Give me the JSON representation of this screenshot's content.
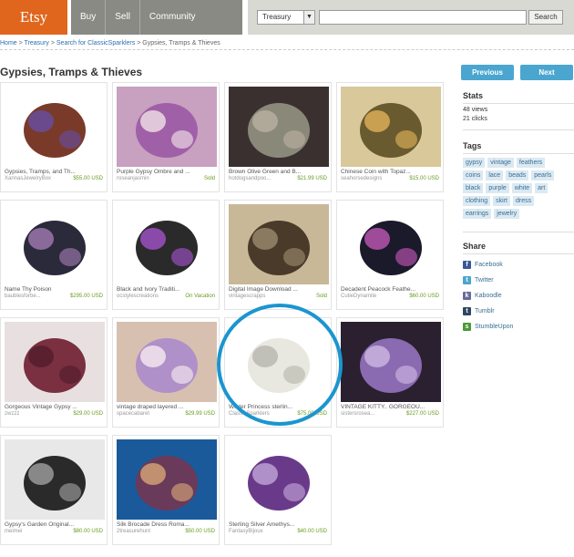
{
  "header": {
    "logo": "Etsy",
    "nav": [
      "Buy",
      "Sell",
      "Community"
    ],
    "search_select": "Treasury",
    "search_button": "Search"
  },
  "breadcrumb": {
    "home": "Home",
    "treasury": "Treasury",
    "search": "Search for ClassicSparklers",
    "current": "Gypsies, Tramps & Thieves"
  },
  "page_title": "Gypsies, Tramps & Thieves",
  "buttons": {
    "previous": "Previous",
    "next": "Next"
  },
  "items": [
    {
      "title": "Gypsies, Tramps, and Th...",
      "shop": "XannasJewelryBox",
      "price": "$55.00 USD",
      "colors": [
        "#ffffff",
        "#7a3a2a",
        "#6a4a8a"
      ]
    },
    {
      "title": "Purple Gypsy Ombre and ...",
      "shop": "roseanjasmin",
      "price": "Sold",
      "colors": [
        "#c8a0c0",
        "#a060a8",
        "#e0c8d8"
      ]
    },
    {
      "title": "Brown Olive Green and B...",
      "shop": "hotdogsandpoo...",
      "price": "$21.99 USD",
      "colors": [
        "#3a3030",
        "#8a8878",
        "#b0a898"
      ]
    },
    {
      "title": "Chinese Coin with Topaz...",
      "shop": "seahorsedesigns",
      "price": "$15.00 USD",
      "colors": [
        "#d8c89a",
        "#6a5a30",
        "#c8a050"
      ]
    },
    {
      "title": "Name Thy Poison",
      "shop": "baublesforbe...",
      "price": "$295.00 USD",
      "colors": [
        "#ffffff",
        "#2a2a3a",
        "#8a6a9a"
      ]
    },
    {
      "title": "Black and Ivory Traditi...",
      "shop": "ocstylescreations",
      "price": "On Vacation",
      "colors": [
        "#ffffff",
        "#2a2a2a",
        "#8a4aaa"
      ]
    },
    {
      "title": "Digital Image Download ...",
      "shop": "vintagescrapps",
      "price": "Sold",
      "colors": [
        "#c8b898",
        "#4a3a2a",
        "#8a7a60"
      ]
    },
    {
      "title": "Decadent Peacock Feathe...",
      "shop": "CutieDynamite",
      "price": "$60.00 USD",
      "colors": [
        "#ffffff",
        "#1a1a2a",
        "#a04a9a"
      ]
    },
    {
      "title": "Gorgeous Vintage Gypsy ...",
      "shop": "zwzzz",
      "price": "$29.00 USD",
      "colors": [
        "#e8e0e0",
        "#7a3040",
        "#5a2030"
      ]
    },
    {
      "title": "vintage draped layered ...",
      "shop": "spacecabaret",
      "price": "$29.99 USD",
      "colors": [
        "#d8c0b0",
        "#b090c8",
        "#e8d8e8"
      ]
    },
    {
      "title": "Winter Princess sterlin...",
      "shop": "ClassicSparklers",
      "price": "$75.00 USD",
      "colors": [
        "#ffffff",
        "#e8e8e0",
        "#c0c0b8"
      ]
    },
    {
      "title": "VINTAGE KITTY.. GORGEOU...",
      "shop": "sistersrosea...",
      "price": "$227.00 USD",
      "colors": [
        "#2a2030",
        "#8a6ab0",
        "#c0a8d8"
      ]
    },
    {
      "title": "Gypsy's Garden Original...",
      "shop": "meimei",
      "price": "$80.00 USD",
      "colors": [
        "#e8e8e8",
        "#2a2a2a",
        "#888888"
      ]
    },
    {
      "title": "Silk Brocade Dress Roma...",
      "shop": "2treasurehunt",
      "price": "$50.00 USD",
      "colors": [
        "#1a5a9a",
        "#6a3a5a",
        "#c09070"
      ]
    },
    {
      "title": "Sterling Silver Amethys...",
      "shop": "FantasyBijoux",
      "price": "$40.00 USD",
      "colors": [
        "#ffffff",
        "#6a3a8a",
        "#b090c8"
      ]
    }
  ],
  "sidebar": {
    "stats_title": "Stats",
    "views": "48 views",
    "clicks": "21 clicks",
    "tags_title": "Tags",
    "tags": [
      "gypsy",
      "vintage",
      "feathers",
      "coins",
      "lace",
      "beads",
      "pearls",
      "black",
      "purple",
      "white",
      "art",
      "clothing",
      "skirt",
      "dress",
      "earrings",
      "jewelry"
    ],
    "share_title": "Share",
    "share": [
      {
        "label": "Facebook",
        "icon": "facebook-icon",
        "color": "#3b5998",
        "glyph": "f"
      },
      {
        "label": "Twitter",
        "icon": "twitter-icon",
        "color": "#4aa6cf",
        "glyph": "t"
      },
      {
        "label": "Kaboodle",
        "icon": "kaboodle-icon",
        "color": "#6a6a9a",
        "glyph": "k"
      },
      {
        "label": "Tumblr",
        "icon": "tumblr-icon",
        "color": "#2c4762",
        "glyph": "t"
      },
      {
        "label": "StumbleUpon",
        "icon": "stumbleupon-icon",
        "color": "#4a9a3a",
        "glyph": "s"
      }
    ]
  }
}
